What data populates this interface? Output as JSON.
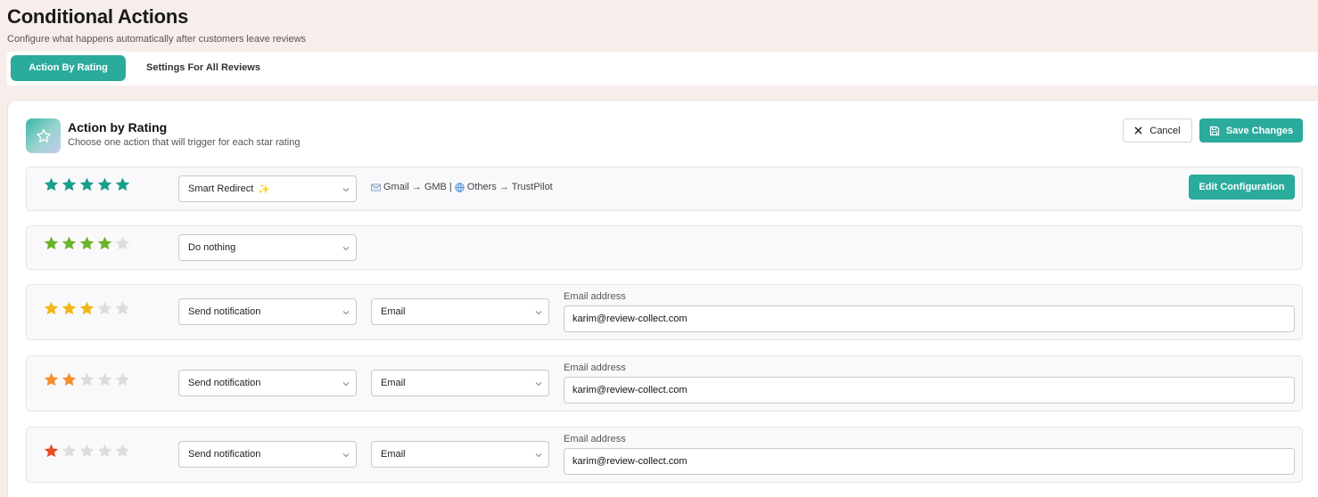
{
  "header": {
    "title": "Conditional Actions",
    "subtitle": "Configure what happens automatically after customers leave reviews"
  },
  "tabs": [
    {
      "label": "Action By Rating",
      "active": true
    },
    {
      "label": "Settings For All Reviews",
      "active": false
    }
  ],
  "card": {
    "title": "Action by Rating",
    "subtitle": "Choose one action that will trigger for each star rating",
    "icon": "star-outline-icon",
    "cancel_label": "Cancel",
    "save_label": "Save Changes"
  },
  "colors": {
    "accent": "#2aab9c",
    "star_5": "#1a9e8a",
    "star_4": "#6ab42a",
    "star_3": "#f2b619",
    "star_2": "#f58e2c",
    "star_1": "#ec4a27",
    "star_empty": "#dcdcdc"
  },
  "rules": [
    {
      "rating": 5,
      "action": "Smart Redirect",
      "action_suffix": "✨",
      "redirect_summary": {
        "part1": "Gmail → GMB",
        "separator": "|",
        "part2": "Others → TrustPilot"
      },
      "edit_label": "Edit Configuration"
    },
    {
      "rating": 4,
      "action": "Do nothing"
    },
    {
      "rating": 3,
      "action": "Send notification",
      "channel": "Email",
      "field_label": "Email address",
      "email": "karim@review-collect.com"
    },
    {
      "rating": 2,
      "action": "Send notification",
      "channel": "Email",
      "field_label": "Email address",
      "email": "karim@review-collect.com"
    },
    {
      "rating": 1,
      "action": "Send notification",
      "channel": "Email",
      "field_label": "Email address",
      "email": "karim@review-collect.com"
    }
  ]
}
